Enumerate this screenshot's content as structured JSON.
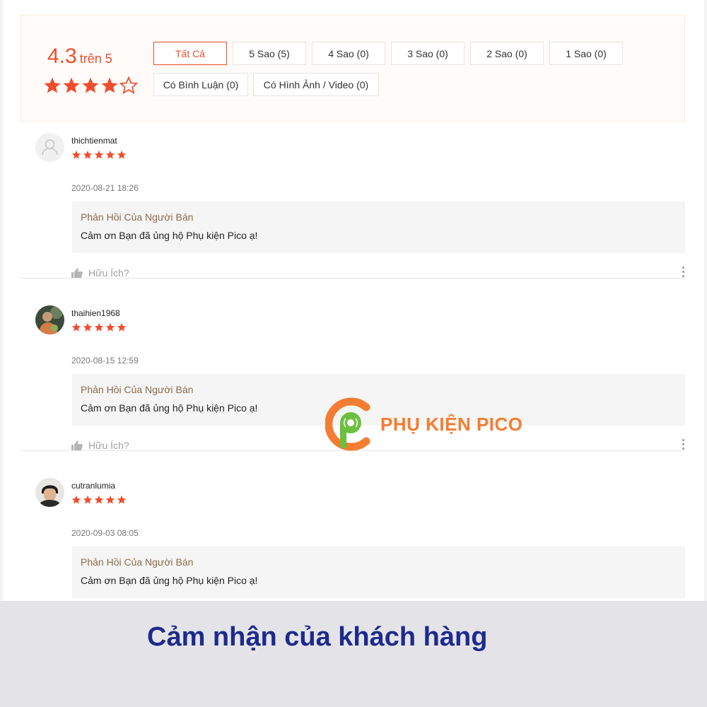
{
  "summary": {
    "score": "4.3",
    "score_unit": "trên 5",
    "rating_stars": 4.3
  },
  "filters": [
    {
      "label": "Tất Cả",
      "active": true
    },
    {
      "label": "5 Sao (5)",
      "active": false
    },
    {
      "label": "4 Sao (0)",
      "active": false
    },
    {
      "label": "3 Sao (0)",
      "active": false
    },
    {
      "label": "2 Sao (0)",
      "active": false
    },
    {
      "label": "1 Sao (0)",
      "active": false
    },
    {
      "label": "Có Bình Luận (0)",
      "active": false
    },
    {
      "label": "Có Hình Ảnh / Video (0)",
      "active": false
    }
  ],
  "reviews": [
    {
      "username": "thichtienmat",
      "rating": 5,
      "time": "2020-08-21 18:26",
      "reply_title": "Phản Hồi Của Người Bán",
      "reply_text": "Cảm ơn Bạn đã ủng hộ Phụ kiện Pico ạ!",
      "helpful_label": "Hữu Ích?",
      "avatar": "default-user-icon"
    },
    {
      "username": "thaihien1968",
      "rating": 5,
      "time": "2020-08-15 12:59",
      "reply_title": "Phản Hồi Của Người Bán",
      "reply_text": "Cảm ơn Bạn đã ủng hộ Phụ kiện Pico ạ!",
      "helpful_label": "Hữu Ích?",
      "avatar": "user-photo"
    },
    {
      "username": "cutranlumia",
      "rating": 5,
      "time": "2020-09-03 08:05",
      "reply_title": "Phản Hồi Của Người Bán",
      "reply_text": "Cảm ơn Bạn đã ủng hộ Phụ kiện Pico ạ!",
      "avatar": "user-photo"
    }
  ],
  "watermark": {
    "text": "PHỤ KIỆN PICO"
  },
  "footer": {
    "caption": "Cảm nhận của khách hàng"
  },
  "colors": {
    "accent": "#ee4d2d",
    "star": "#ee4d2d",
    "caption": "#1e2a8c",
    "watermark_orange": "#f47d31",
    "watermark_green": "#6cbf3f"
  }
}
